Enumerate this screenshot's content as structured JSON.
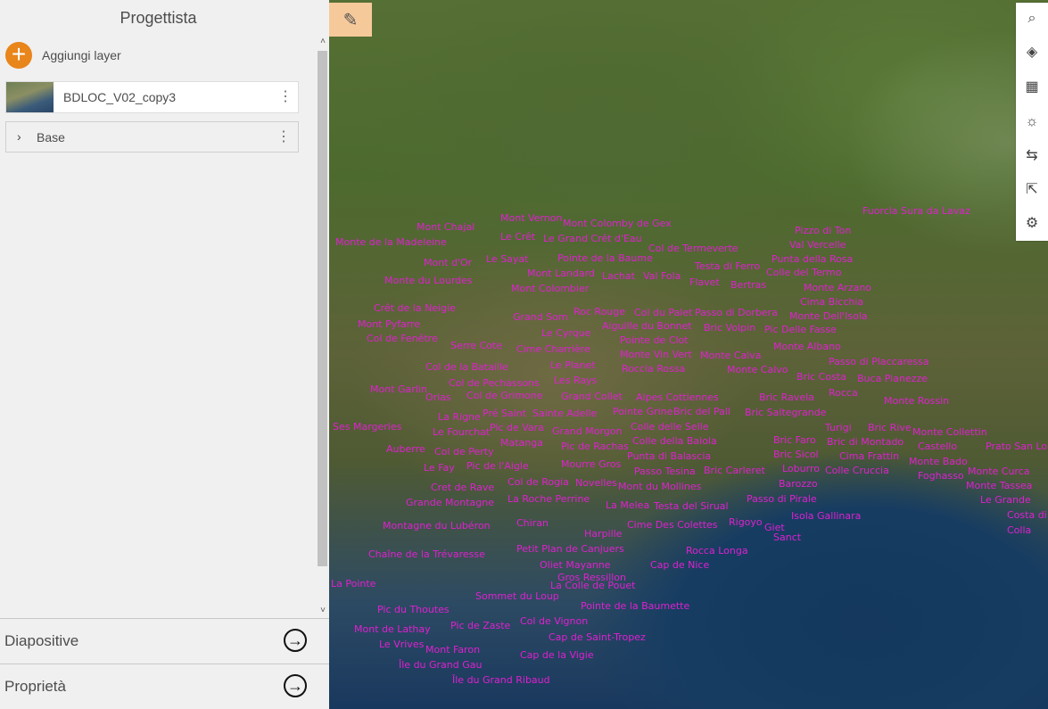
{
  "panel": {
    "title": "Progettista",
    "add_layer_label": "Aggiungi layer",
    "add_icon": "+",
    "layer_name": "BDLOC_V02_copy3",
    "kebab_glyph": "⋮",
    "base_label": "Base",
    "chevron_glyph": "›",
    "section_slides": "Diapositive",
    "section_properties": "Proprietà",
    "arrow_glyph": "→",
    "scroll_up": "˄",
    "scroll_down": "˅"
  },
  "map": {
    "edit_icon": "✎",
    "tools": {
      "search": "⌕",
      "layers": "◈",
      "qr": "▦",
      "daylight": "☼",
      "measure": "⇆",
      "share": "⇱",
      "settings": "⚙"
    },
    "labels": [
      "Fuorcla Sura da Lavaz",
      "Mont Vernon",
      "Mont Colomby de Gex",
      "Mont Chajal",
      "Le Crêt",
      "Le Grand Crêt d'Eau",
      "Monte de la Madeleine",
      "Col de Termeverte",
      "Pizzo di Ton",
      "Val Vercelle",
      "Mont d'Or",
      "Le Sayat",
      "Pointe de la Baume",
      "Testa di Ferro",
      "Punta della Rosa",
      "Mont Landard",
      "Lachat",
      "Val Fola",
      "Colle del Termo",
      "Monte du Lourdes",
      "Mont Colombier",
      "Flavet",
      "Bertras",
      "Monte Arzano",
      "Cima Bicchia",
      "Crêt de la Neigie",
      "Mont Pyfarre",
      "Grand Som",
      "Roc Rouge",
      "Col du Palet",
      "Passo di Dorbera",
      "Monte Dell'Isola",
      "Col de Fenêtre",
      "Le Cyrque",
      "Aiguille du Bonnet",
      "Bric Volpin",
      "Pic Delle Fasse",
      "Serre Cote",
      "Cime Charrière",
      "Pointe de Clot",
      "Monte Albano",
      "Monte Vin Vert",
      "Monte Calva",
      "Col de la Bataille",
      "Le Planet",
      "Roccia Rossa",
      "Passo di Placcaressa",
      "Col de Pechassons",
      "Les Rays",
      "Monte Calvo",
      "Bric Costa",
      "Buca Pianezze",
      "Mont Garlin",
      "Orias",
      "Col de Grimone",
      "Grand Collet",
      "Alpes Cottiennes",
      "Bric Ravela",
      "Rocca",
      "Monte Rossin",
      "La Rigne",
      "Pré Saint",
      "Sainte Adelle",
      "Pointe Grine",
      "Bric del Pall",
      "Bric Saltegrande",
      "Ses Margeries",
      "Le Fourchat",
      "Pic de Vara",
      "Grand Morgon",
      "Colle delle Selle",
      "Turigi",
      "Bric Rive",
      "Monte Collettin",
      "Matanga",
      "Pic de Rachas",
      "Colle della Baiola",
      "Bric Faro",
      "Bric di Montado",
      "Castello",
      "Prato San Lorenzo",
      "Auberre",
      "Col de Perty",
      "Punta di Balascia",
      "Bric Sicol",
      "Cima Frattin",
      "Monte Bado",
      "Le Fay",
      "Pic de l'Aigle",
      "Mourre Gros",
      "Passo Tesina",
      "Bric Carleret",
      "Loburro",
      "Colle Cruccia",
      "Foghasso",
      "Monte Curca",
      "Cret de Rave",
      "Col de Rogia",
      "Novelles",
      "Mont du Mollines",
      "Barozzo",
      "Monte Tassea",
      "Grande Montagne",
      "La Roche Perrine",
      "La Melea",
      "Testa del Sirual",
      "Passo di Pirale",
      "Le Grande",
      "Montagne du Lubéron",
      "Chiran",
      "Cime Des Colettes",
      "Rigoyo",
      "Giet",
      "Isola Gallinara",
      "Costa di",
      "Colla",
      "Harpille",
      "Petit Plan de Canjuers",
      "Rocca Longa",
      "Chaîne de la Trévaresse",
      "Sanct",
      "Oliet Mayanne",
      "Cap de Nice",
      "Gros Ressillon",
      "La Pointe",
      "Sommet du Loup",
      "La Colle de Pouet",
      "Pic du Thoutes",
      "Pointe de la Baumette",
      "Col de Vignon",
      "Mont de Lathay",
      "Pic de Zaste",
      "Le Vrives",
      "Cap de Saint-Tropez",
      "Mont Faron",
      "Cap de la Vigie",
      "Île du Grand Gau",
      "Île du Grand Ribaud"
    ]
  }
}
